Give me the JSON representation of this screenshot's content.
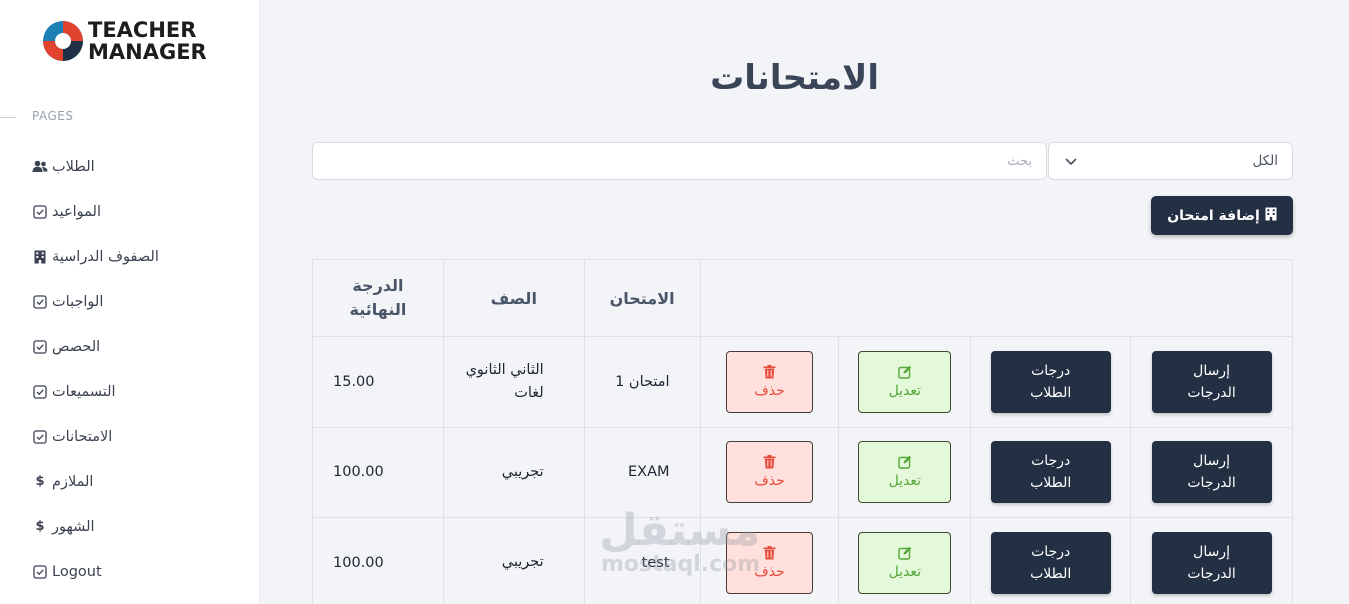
{
  "brand": {
    "line1": "TEACHER",
    "line2": "MANAGER"
  },
  "sidebar": {
    "section_label": "PAGES",
    "items": [
      {
        "label": "الطلاب",
        "icon": "users-icon"
      },
      {
        "label": "المواعيد",
        "icon": "check-square-icon"
      },
      {
        "label": "الصفوف الدراسية",
        "icon": "building-icon"
      },
      {
        "label": "الواجبات",
        "icon": "check-square-icon"
      },
      {
        "label": "الحصص",
        "icon": "check-square-icon"
      },
      {
        "label": "التسميعات",
        "icon": "check-square-icon"
      },
      {
        "label": "الامتحانات",
        "icon": "check-square-icon"
      },
      {
        "label": "الملازم",
        "icon": "dollar-icon"
      },
      {
        "label": "الشهور",
        "icon": "dollar-icon"
      },
      {
        "label": "Logout",
        "icon": "check-square-icon"
      }
    ]
  },
  "page": {
    "title": "الامتحانات",
    "search_placeholder": "بحث",
    "filter_selected": "الكل",
    "add_button": "إضافة امتحان"
  },
  "table": {
    "headers": {
      "exam": "الامتحان",
      "class": "الصف",
      "final_line1": "الدرجة",
      "final_line2": "النهائية"
    },
    "actions": {
      "send_grades": "إرسال\nالدرجات",
      "student_grades": "درجات\nالطلاب",
      "edit": "تعديل",
      "delete": "حذف"
    },
    "rows": [
      {
        "exam": "امتحان 1",
        "class_line1": "الثاني الثانوي",
        "class_line2": "لغات",
        "final": "15.00"
      },
      {
        "exam": "EXAM",
        "class_line1": "تجريبي",
        "class_line2": "",
        "final": "100.00"
      },
      {
        "exam": "test",
        "class_line1": "تجريبي",
        "class_line2": "",
        "final": "100.00"
      }
    ]
  },
  "watermark": {
    "ar": "مستقل",
    "en": "mostaql.com"
  },
  "colors": {
    "dark": "#232f42",
    "edit_bg": "#e4f8da",
    "edit_fg": "#56a63a",
    "delete_bg": "#ffe0dc",
    "delete_fg": "#e74c3c"
  }
}
